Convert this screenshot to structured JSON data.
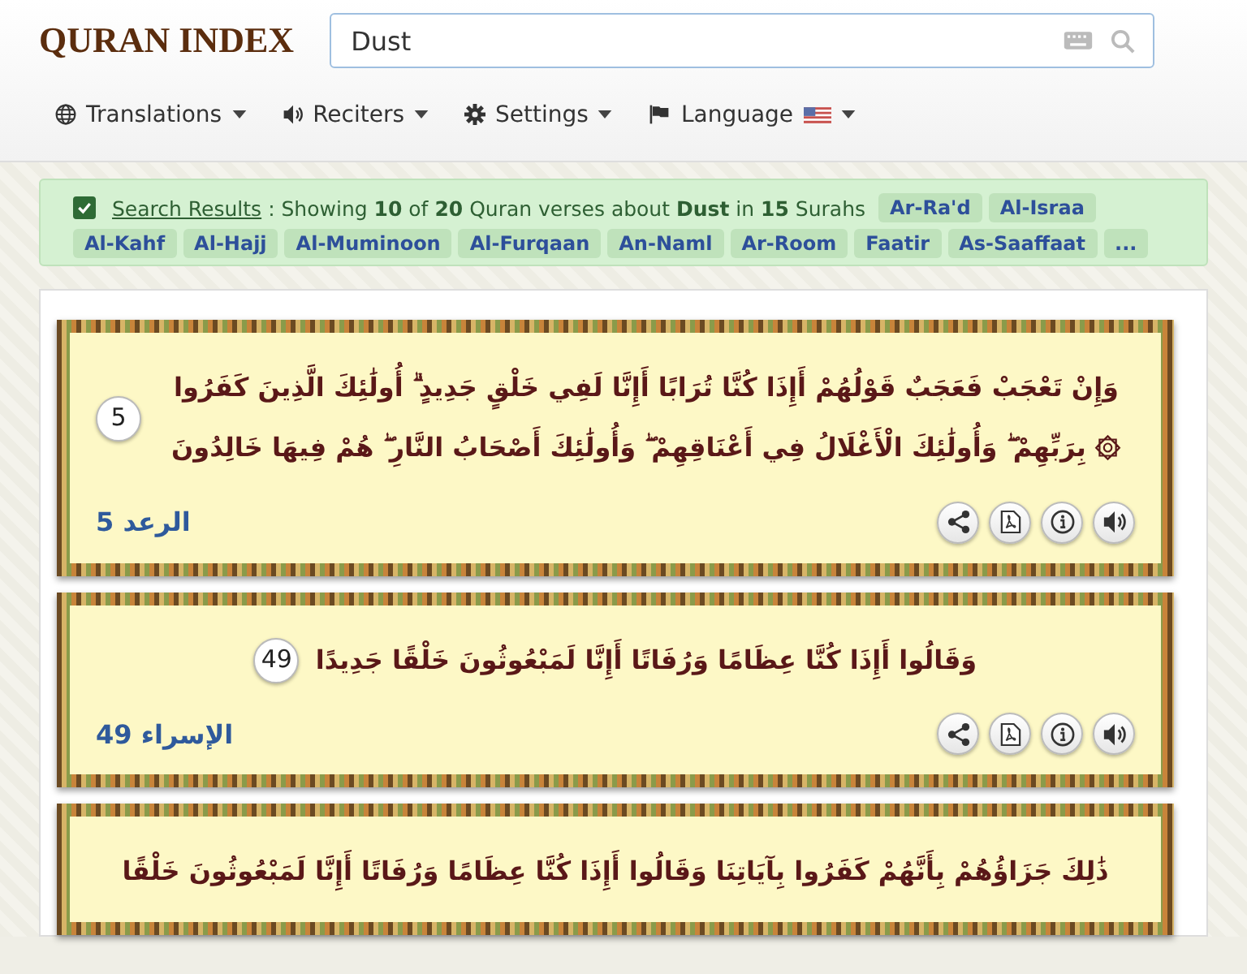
{
  "logo": "QURAN INDEX",
  "search": {
    "value": "Dust"
  },
  "nav": [
    {
      "label": "Translations"
    },
    {
      "label": "Reciters"
    },
    {
      "label": "Settings"
    },
    {
      "label": "Language"
    }
  ],
  "results": {
    "checked": true,
    "link": "Search Results",
    "summary": ": Showing **10** of **20** Quran verses about **Dust** in **15** Surahs",
    "surahs": [
      "Ar-Ra'd",
      "Al-Israa",
      "Al-Kahf",
      "Al-Hajj",
      "Al-Muminoon",
      "Al-Furqaan",
      "An-Naml",
      "Ar-Room",
      "Faatir",
      "As-Saaffaat",
      "..."
    ]
  },
  "verses": [
    {
      "text": "وَإِنْ تَعْجَبْ فَعَجَبٌ قَوْلُهُمْ أَإِذَا كُنَّا تُرَابًا أَإِنَّا لَفِي خَلْقٍ جَدِيدٍ ۗ أُولَٰئِكَ الَّذِينَ كَفَرُوا ۞ بِرَبِّهِمْ ۖ وَأُولَٰئِكَ الْأَغْلَالُ فِي أَعْنَاقِهِمْ ۖ وَأُولَٰئِكَ أَصْحَابُ النَّارِ ۖ هُمْ فِيهَا خَالِدُونَ",
      "number": "5",
      "reference": "الرعد 5"
    },
    {
      "text": "وَقَالُوا أَإِذَا كُنَّا عِظَامًا وَرُفَاتًا أَإِنَّا لَمَبْعُوثُونَ خَلْقًا جَدِيدًا",
      "number": "49",
      "reference": "الإسراء 49"
    },
    {
      "text": "ذَٰلِكَ جَزَاؤُهُمْ بِأَنَّهُمْ كَفَرُوا بِآيَاتِنَا وَقَالُوا أَإِذَا كُنَّا عِظَامًا وَرُفَاتًا أَإِنَّا لَمَبْعُوثُونَ خَلْقًا"
    }
  ]
}
